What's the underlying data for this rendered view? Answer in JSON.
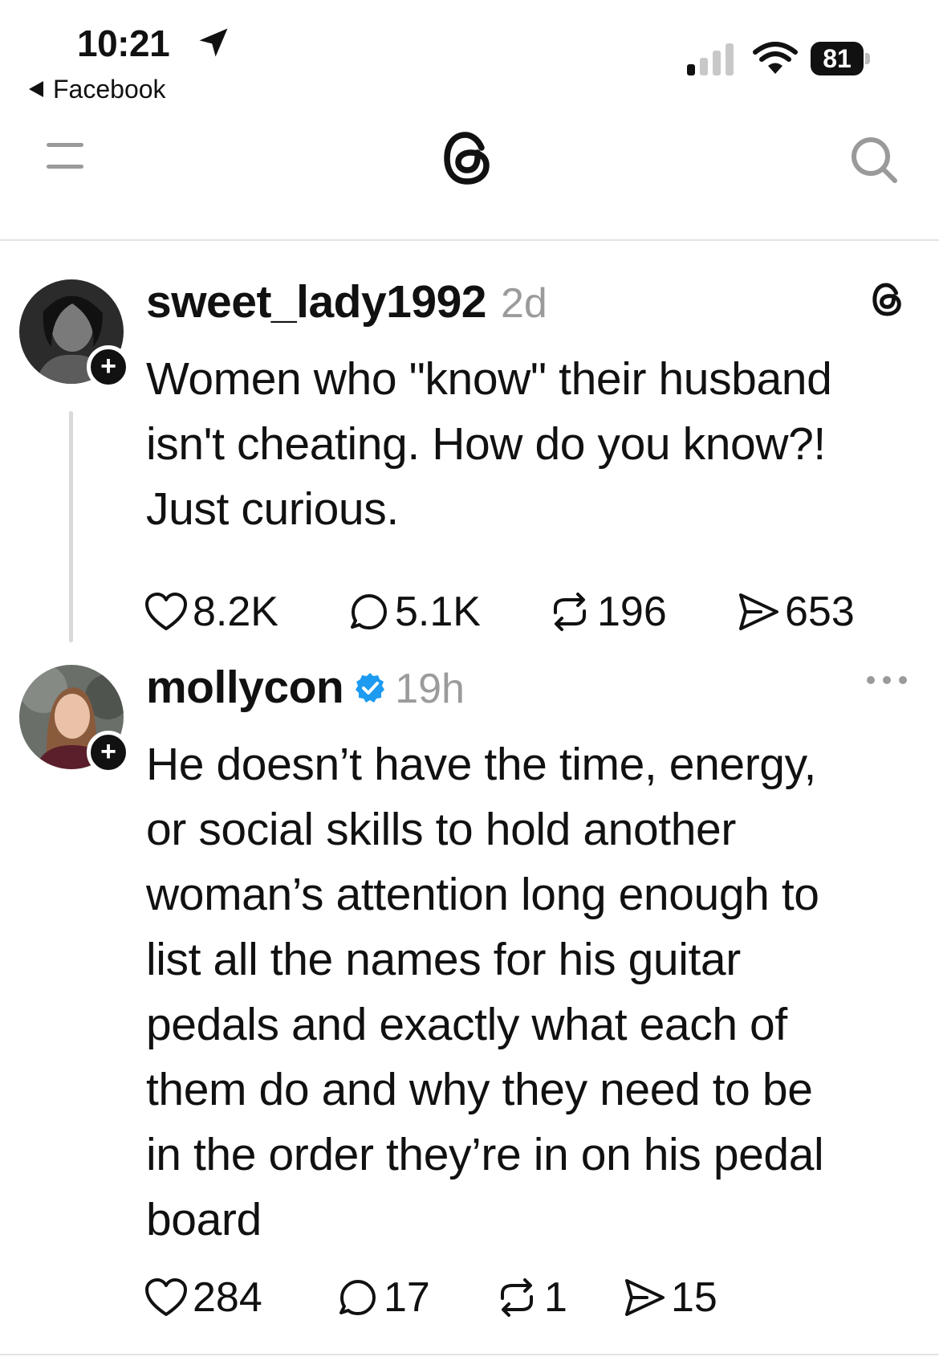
{
  "status_bar": {
    "time": "10:21",
    "back_app": "Facebook",
    "battery": "81"
  },
  "header": {
    "menu_icon": "menu-icon",
    "logo_icon": "threads-logo-icon",
    "search_icon": "search-icon"
  },
  "posts": [
    {
      "username": "sweet_lady1992",
      "time": "2d",
      "verified": false,
      "text_lines": [
        "Women who \"know\" their husband",
        "isn't cheating. How do you know?!",
        "Just curious."
      ],
      "likes": "8.2K",
      "replies": "5.1K",
      "reposts": "196",
      "shares": "653"
    },
    {
      "username": "mollycon",
      "time": "19h",
      "verified": true,
      "text_lines": [
        "He doesn’t have the time, energy,",
        "or social skills to hold another",
        "woman’s attention long enough to",
        "list all the names for his guitar",
        "pedals and exactly what each of",
        "them do and why they need to be",
        "in the order they’re in on his pedal",
        "board"
      ],
      "likes": "284",
      "replies": "17",
      "reposts": "1",
      "shares": "15"
    }
  ],
  "colors": {
    "text": "#111111",
    "muted": "#9b9b9b",
    "verified": "#1d9bf0",
    "divider": "#e3e3e3"
  }
}
